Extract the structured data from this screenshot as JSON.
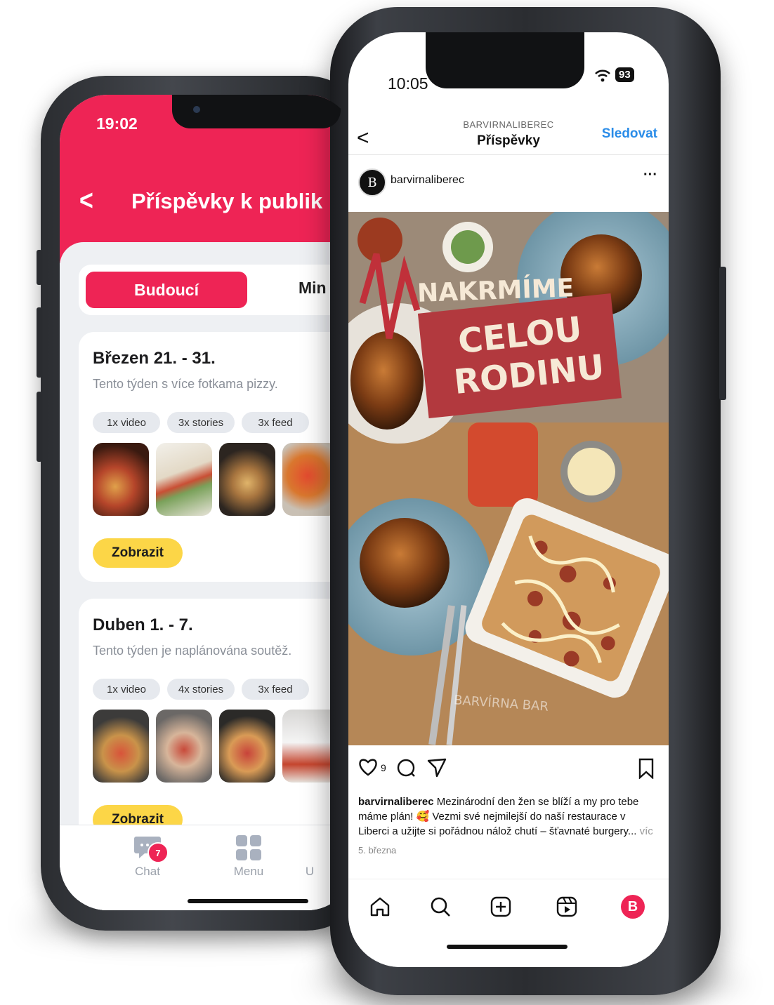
{
  "left_app": {
    "status_time": "19:02",
    "header_title": "Příspěvky k publik",
    "tabs": {
      "active": "Budoucí",
      "other": "Min"
    },
    "cards": [
      {
        "title": "Březen 21. - 31.",
        "description": "Tento týden s více fotkama pizzy.",
        "chips": [
          "1x video",
          "3x stories",
          "3x feed"
        ],
        "button": "Zobrazit"
      },
      {
        "title": "Duben 1. - 7.",
        "description": "Tento týden je naplánována soutěž.",
        "chips": [
          "1x video",
          "4x stories",
          "3x feed"
        ],
        "button": "Zobrazit"
      }
    ],
    "bottom_nav": [
      {
        "label": "Chat",
        "icon": "chat-icon",
        "badge": "7"
      },
      {
        "label": "Menu",
        "icon": "grid-icon"
      },
      {
        "label": "U",
        "icon": "user-icon"
      }
    ],
    "colors": {
      "brand": "#ee2455",
      "accent": "#fcd647"
    }
  },
  "right_app": {
    "status_time": "10:05",
    "battery": "93",
    "header_subtitle": "BARVIRNALIBEREC",
    "header_title": "Příspěvky",
    "follow_label": "Sledovat",
    "post": {
      "username": "barvirnaliberec",
      "avatar_letter": "B",
      "overlay_line1": "NAKRMÍME",
      "overlay_line2": "CELOU",
      "overlay_line3": "RODINU",
      "image_caption_text": "BARVÍRNA BAR",
      "likes": "9",
      "caption_user": "barvirnaliberec",
      "caption_text": "Mezinárodní den žen se blíží a my pro tebe máme plán! 🥰 Vezmi své nejmilejší do naší restaurace v Liberci a užijte si pořádnou nálož chutí – šťavnaté burgery...",
      "caption_more": "víc",
      "date": "5. března"
    },
    "nav_icons": [
      "home-icon",
      "search-icon",
      "add-post-icon",
      "reels-icon",
      "profile-icon"
    ],
    "colors": {
      "link": "#2a8ce8"
    }
  }
}
